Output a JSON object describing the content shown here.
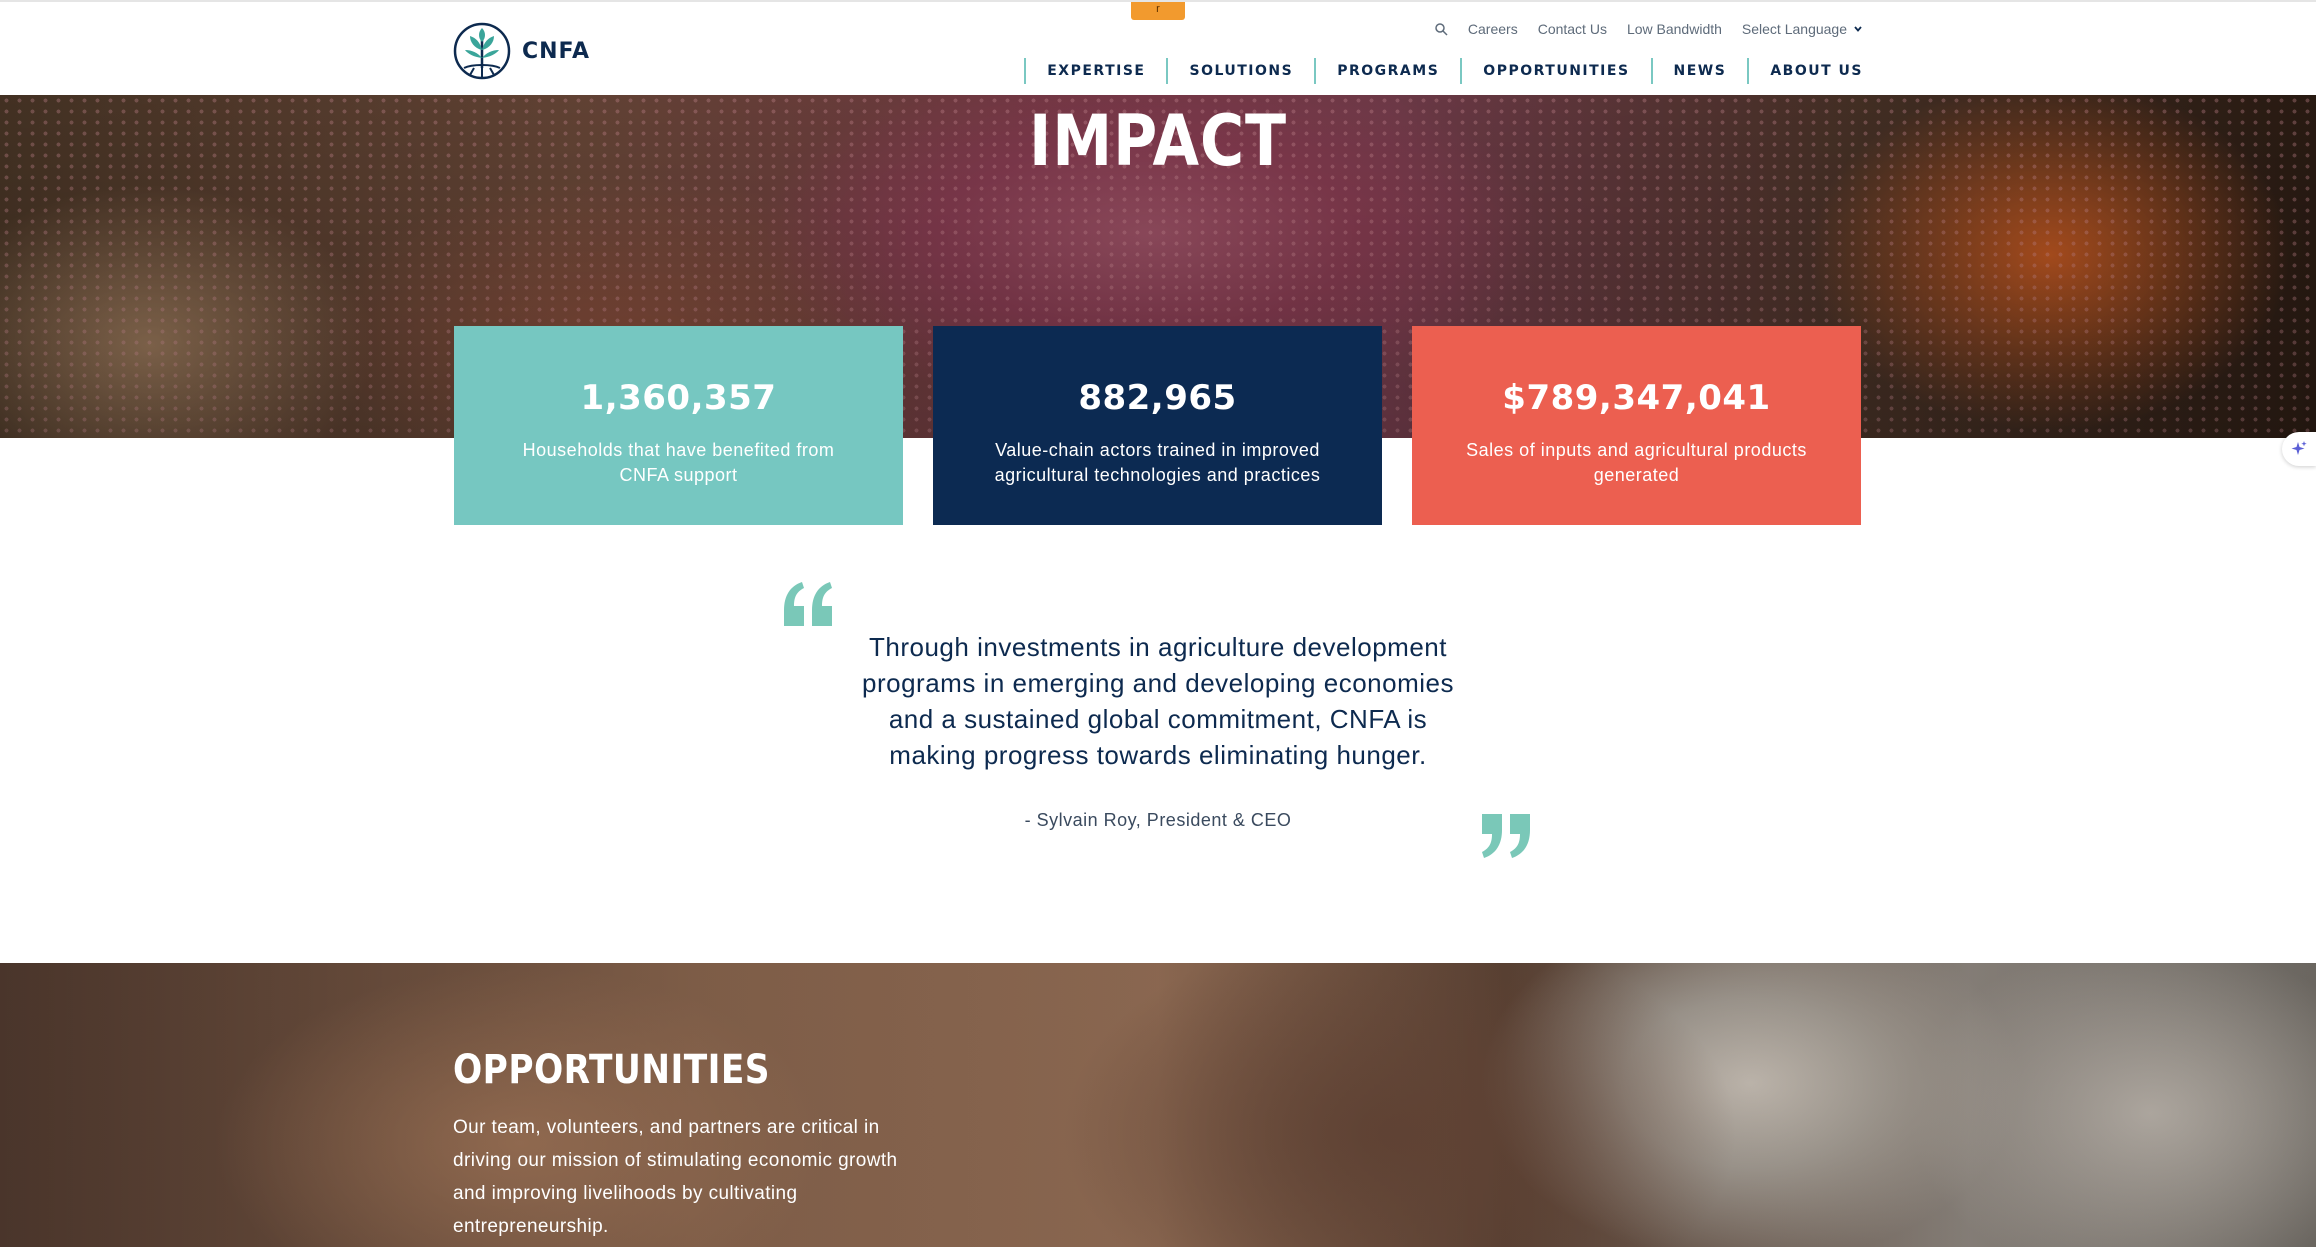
{
  "header": {
    "logo_text": "CNFA",
    "orange_tab": "r",
    "utility": {
      "careers": "Careers",
      "contact": "Contact Us",
      "low_bandwidth": "Low Bandwidth",
      "language": "Select Language"
    },
    "nav": [
      {
        "label": "EXPERTISE"
      },
      {
        "label": "SOLUTIONS"
      },
      {
        "label": "PROGRAMS"
      },
      {
        "label": "OPPORTUNITIES"
      },
      {
        "label": "NEWS"
      },
      {
        "label": "ABOUT US"
      }
    ]
  },
  "hero": {
    "title": "IMPACT"
  },
  "stats": [
    {
      "value": "1,360,357",
      "label": "Households that have benefited from CNFA support",
      "color": "#76c7c1"
    },
    {
      "value": "882,965",
      "label": "Value-chain actors trained in improved agricultural technologies and practices",
      "color": "#0c2a52"
    },
    {
      "value": "$789,347,041",
      "label": "Sales of inputs and agricultural products generated",
      "color": "#ec5f50"
    }
  ],
  "quote": {
    "text": "Through investments in agriculture development programs in emerging and developing economies and a sustained global commitment, CNFA is making progress towards eliminating hunger.",
    "author": "- Sylvain Roy, President & CEO",
    "mark_color": "#7ac8b8"
  },
  "opportunities": {
    "title": "OPPORTUNITIES",
    "text": "Our team, volunteers, and partners are critical in driving our mission of stimulating economic growth and improving livelihoods by cultivating entrepreneurship."
  },
  "colors": {
    "navy": "#0d2a4f",
    "teal": "#7ac8c2",
    "coral": "#ec5f50"
  }
}
